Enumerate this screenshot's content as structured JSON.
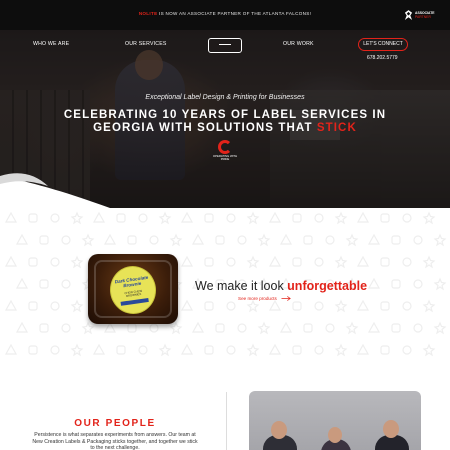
{
  "announcement": {
    "brand": "NOLITE",
    "text": " IS NOW AN ASSOCIATE PARTNER OF THE ATLANTA FALCONS!"
  },
  "partner_badge": {
    "line1": "ASSOCIATE",
    "line2": "PARTNER"
  },
  "nav": {
    "items": [
      "WHO WE ARE",
      "OUR SERVICES",
      "OUR WORK"
    ],
    "cta": "LET'S CONNECT",
    "phone": "678.202.5779"
  },
  "hero": {
    "tagline": "Exceptional Label Design & Printing for Businesses",
    "headline": "CELEBRATING 10 YEARS OF LABEL SERVICES IN GEORGIA WITH SOLUTIONS THAT ",
    "headline_accent": "STICK",
    "award_text": "OPERATING WITH PRIDE"
  },
  "product_label": {
    "title": "Dark Chocolate Brownie",
    "sub": "CHEW CHEW BROWNIES"
  },
  "feature": {
    "text": "We make it look ",
    "accent": "unforgettable",
    "link": "See more products"
  },
  "people": {
    "title": "OUR PEOPLE",
    "body": "Persistence is what separates experiments from answers. Our team at New Creation Labels & Packaging sticks together, and together we stick to the next challenge."
  },
  "colors": {
    "accent": "#e2231a",
    "dark": "#0d0d0d"
  },
  "icons": [
    "falcon-logo-icon",
    "company-logo-icon",
    "award-badge-icon",
    "arrow-right-icon"
  ]
}
